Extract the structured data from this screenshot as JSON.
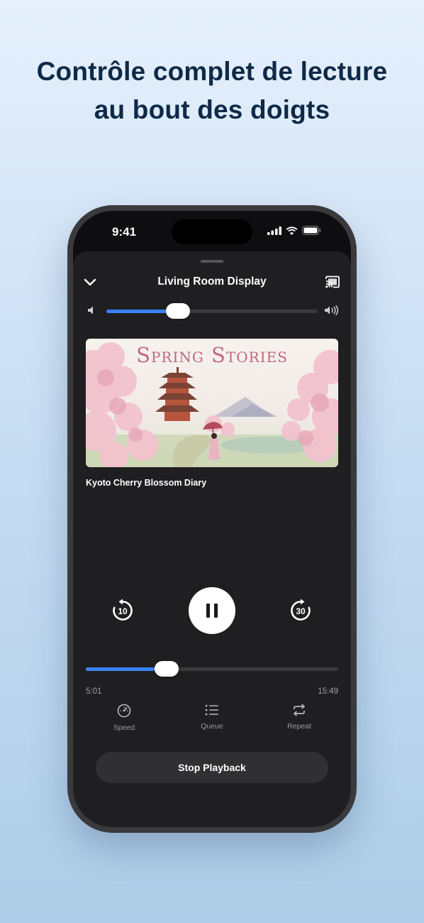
{
  "headline": {
    "line1": "Contrôle complet de lecture",
    "line2": "au bout des doigts"
  },
  "status_bar": {
    "time": "9:41",
    "icons": [
      "signal-icon",
      "wifi-icon",
      "battery-icon"
    ]
  },
  "player": {
    "device_name": "Living Room Display",
    "volume_fraction": 0.34,
    "artwork_title": "Spring Stories",
    "track_title": "Kyoto Cherry Blossom Diary",
    "skip_back_seconds": "10",
    "skip_forward_seconds": "30",
    "state": "playing",
    "elapsed": "5:01",
    "duration": "15:49",
    "progress_fraction": 0.32,
    "actions": [
      {
        "label": "Speed",
        "icon": "speedometer-icon"
      },
      {
        "label": "Queue",
        "icon": "list-icon"
      },
      {
        "label": "Repeat",
        "icon": "repeat-icon"
      }
    ],
    "stop_label": "Stop Playback"
  },
  "colors": {
    "accent": "#3b82f6",
    "sheet": "#1f1f21",
    "headline": "#0f2a47"
  }
}
